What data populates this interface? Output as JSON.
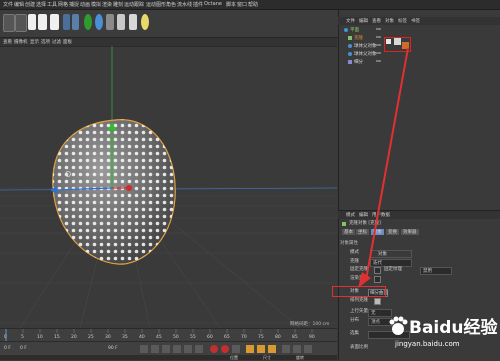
{
  "menu": {
    "items": [
      "文件",
      "编辑",
      "创建",
      "选择",
      "工具",
      "网格",
      "捕捉",
      "动画",
      "模拟",
      "渲染",
      "雕刻",
      "运动跟踪",
      "运动图形",
      "角色",
      "流水线",
      "插件",
      "Octane",
      "脚本",
      "窗口",
      "帮助"
    ]
  },
  "object_manager": {
    "tabs": [
      "文件",
      "编辑",
      "查看",
      "对象",
      "标签",
      "书签"
    ],
    "objects": [
      {
        "name": "平面",
        "indent": 0
      },
      {
        "name": "克隆",
        "indent": 1
      },
      {
        "name": "球体父对象",
        "indent": 1
      },
      {
        "name": "球体父对象",
        "indent": 1
      },
      {
        "name": "细分",
        "indent": 1
      }
    ]
  },
  "attributes": {
    "tabs": [
      "模式",
      "编辑",
      "用户数据"
    ],
    "object_label": "克隆对象 [克隆]",
    "sub_tabs": [
      "基本",
      "坐标",
      "对象",
      "变换",
      "效果器"
    ],
    "section": "对象属性",
    "rows": [
      {
        "label": "模式",
        "value": "对象"
      },
      {
        "label": "克隆",
        "value": "迭代"
      },
      {
        "label": "固定克隆",
        "value": "固定纹理"
      },
      {
        "label": "渲染实例",
        "value": ""
      },
      {
        "label": "对象",
        "value": "平面"
      },
      {
        "label": "排列克隆",
        "value": ""
      },
      {
        "label": "上行矢量",
        "value": "无"
      },
      {
        "label": "分布",
        "value": "顶点"
      },
      {
        "label": "选集",
        "value": ""
      },
      {
        "label": "表面比例",
        "value": ""
      }
    ],
    "highlight_label": "对象",
    "highlight_value": "细分曲面",
    "extra_value": "禁用"
  },
  "viewport": {
    "menu": [
      "查看",
      "摄像机",
      "显示",
      "选项",
      "过滤",
      "面板"
    ],
    "grid_label": "网格间距：100 cm"
  },
  "timeline": {
    "ticks": [
      "0",
      "5",
      "10",
      "15",
      "20",
      "25",
      "30",
      "35",
      "40",
      "45",
      "50",
      "55",
      "60",
      "65",
      "70",
      "75",
      "80",
      "85",
      "90"
    ],
    "frame_start": "0 F",
    "frame_end": "90 F",
    "current": "0 F"
  },
  "bottom_labels": [
    "位置",
    "尺寸",
    "旋转"
  ],
  "watermark": {
    "brand": "Baidu经验",
    "url": "jingyan.baidu.com"
  },
  "colors": {
    "accent": "#e23030",
    "viewport_bg": "#3a3a3a"
  }
}
